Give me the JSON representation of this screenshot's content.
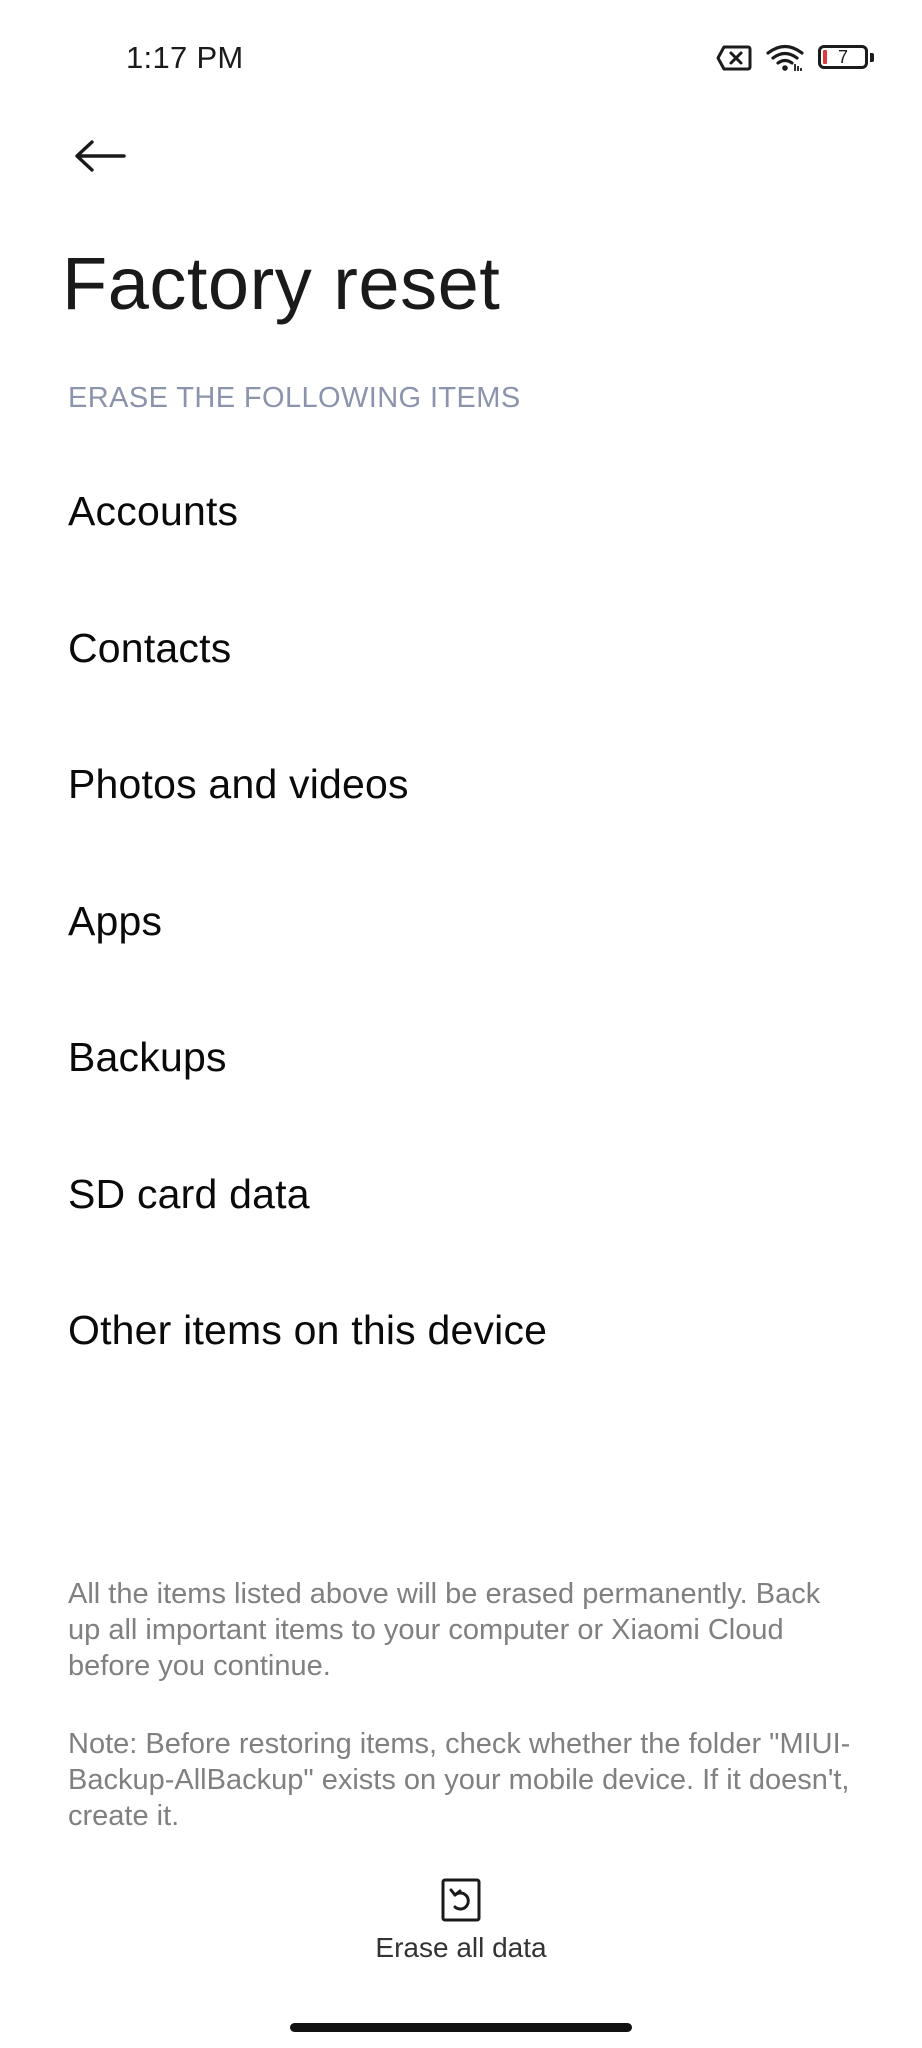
{
  "status_bar": {
    "time": "1:17 PM",
    "icons": [
      "sim-card-missing-icon",
      "wifi-icon",
      "battery-icon"
    ],
    "battery_level": "7",
    "battery_low_color": "#e23a3a"
  },
  "header": {
    "back_icon": "back-arrow-icon",
    "title": "Factory reset"
  },
  "section": {
    "header": "ERASE THE FOLLOWING ITEMS",
    "items": [
      {
        "label": "Accounts"
      },
      {
        "label": "Contacts"
      },
      {
        "label": "Photos and videos"
      },
      {
        "label": "Apps"
      },
      {
        "label": "Backups"
      },
      {
        "label": "SD card data"
      },
      {
        "label": "Other items on this device"
      }
    ]
  },
  "info": {
    "warning": "All the items listed above will be erased permanently. Back up all important items to your computer or Xiaomi Cloud before you continue.",
    "note": "Note: Before restoring items, check whether the folder \"MIUI-Backup-AllBackup\" exists on your mobile device. If it doesn't, create it."
  },
  "action": {
    "icon": "reset-icon",
    "label": "Erase all data"
  },
  "colors": {
    "section_header": "#8b93ad",
    "body_text": "#808080"
  }
}
